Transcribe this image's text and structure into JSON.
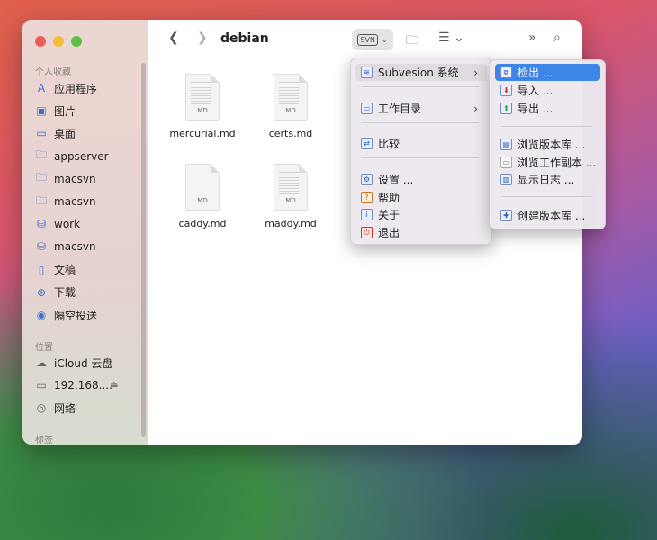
{
  "window": {
    "title": "debian"
  },
  "sidebar": {
    "sections": [
      "个人收藏",
      "位置",
      "标签"
    ],
    "favorites": [
      {
        "label": "应用程序",
        "icon": "applications-icon"
      },
      {
        "label": "图片",
        "icon": "pictures-icon"
      },
      {
        "label": "桌面",
        "icon": "desktop-icon"
      },
      {
        "label": "appserver",
        "icon": "folder-icon"
      },
      {
        "label": "macsvn",
        "icon": "folder-icon"
      },
      {
        "label": "macsvn",
        "icon": "folder-icon"
      },
      {
        "label": "work",
        "icon": "svn-folder-icon"
      },
      {
        "label": "macsvn",
        "icon": "svn-folder-icon"
      },
      {
        "label": "文稿",
        "icon": "document-icon"
      },
      {
        "label": "下载",
        "icon": "download-icon"
      },
      {
        "label": "隔空投送",
        "icon": "airdrop-icon"
      }
    ],
    "locations": [
      {
        "label": "iCloud 云盘",
        "icon": "cloud-icon"
      },
      {
        "label": "192.168....",
        "icon": "computer-icon"
      },
      {
        "label": "网络",
        "icon": "network-icon"
      }
    ]
  },
  "files": [
    {
      "name": "mercurial.md",
      "badge": "MD"
    },
    {
      "name": "certs.md",
      "badge": "MD"
    },
    {
      "name": "caddy.md",
      "badge": "MD"
    },
    {
      "name": "maddy.md",
      "badge": "MD"
    }
  ],
  "menu": {
    "items": [
      "Subvesion 系统",
      "工作目录",
      "比较",
      "设置 ...",
      "帮助",
      "关于",
      "退出"
    ]
  },
  "submenu": {
    "items": [
      "检出 ...",
      "导入 ...",
      "导出 ...",
      "浏览版本库 ...",
      "浏览工作副本 ...",
      "显示日志 ...",
      "创建版本库 ..."
    ]
  },
  "toolbar": {
    "svn_badge": "SVN"
  },
  "colors": {
    "highlight": "#3d86e8",
    "accent": "#3a6fd0"
  }
}
